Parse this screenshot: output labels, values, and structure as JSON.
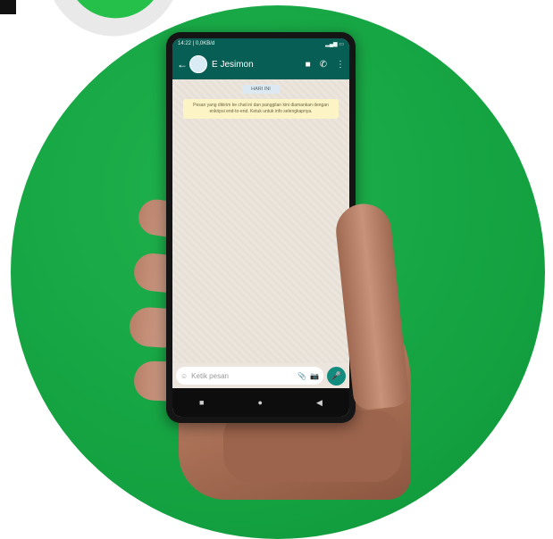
{
  "status_bar": {
    "time": "14:22 | 0,0KB/d",
    "right_icons": "▂▄▆ ▭"
  },
  "header": {
    "back": "←",
    "contact_name": "E Jesimon",
    "video_icon": "■",
    "call_icon": "✆",
    "menu_icon": "⋮"
  },
  "chat": {
    "date_label": "HARI INI",
    "encryption_notice": "Pesan yang dikirim ke chat ini dan panggilan kini diamankan dengan enkripsi end-to-end. Ketuk untuk info selengkapnya."
  },
  "input": {
    "emoji_icon": "☺",
    "placeholder": "Ketik pesan",
    "attach_icon": "📎",
    "camera_icon": "📷",
    "mic_icon": "🎤"
  },
  "nav": {
    "recents": "■",
    "home": "●",
    "back": "◀"
  },
  "colors": {
    "brand_green": "#13a040",
    "header": "#075e54",
    "accent": "#128c7e"
  }
}
